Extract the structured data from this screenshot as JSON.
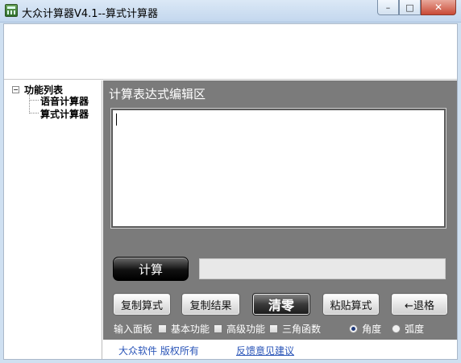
{
  "window": {
    "title": "大众计算器V4.1--算式计算器",
    "minimize": "–",
    "maximize": "□",
    "close": "✕"
  },
  "tree": {
    "root_label": "功能列表",
    "expander": "−",
    "items": [
      {
        "label": "语音计算器"
      },
      {
        "label": "算式计算器"
      }
    ]
  },
  "editor": {
    "label": "计算表达式编辑区",
    "value": ""
  },
  "calculate_label": "计算",
  "result_value": "",
  "buttons": {
    "copy_expr": "复制算式",
    "copy_result": "复制结果",
    "clear": "清零",
    "paste_expr": "粘贴算式",
    "backspace": "←退格"
  },
  "options": {
    "input_panel_label": "输入面板",
    "basic": {
      "label": "基本功能",
      "checked": false
    },
    "advanced": {
      "label": "高级功能",
      "checked": false
    },
    "trig": {
      "label": "三角函数",
      "checked": false
    },
    "degree": {
      "label": "角度",
      "selected": true
    },
    "radian": {
      "label": "弧度",
      "selected": false
    }
  },
  "footer": {
    "copyright": "大众软件  版权所有",
    "feedback": "反馈意见建议"
  }
}
